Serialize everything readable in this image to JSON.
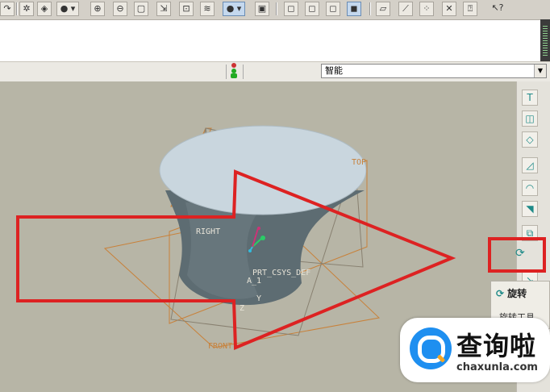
{
  "toolbar": {
    "icons": [
      "redo-icon",
      "regenerate-icon",
      "repaint-icon",
      "shading-icon",
      "zoom-in-icon",
      "zoom-out-icon",
      "refit-icon",
      "reorient-icon",
      "saved-view-icon",
      "layers-icon",
      "appearance-icon",
      "snapshot-icon",
      "wireframe-icon",
      "hidden-line-icon",
      "no-hidden-icon",
      "shaded-icon",
      "datum-planes-icon",
      "datum-axes-icon",
      "datum-points-icon",
      "csys-icon",
      "annotations-icon",
      "whats-this-icon"
    ]
  },
  "filter": {
    "selected": "智能"
  },
  "viewport": {
    "datum_labels": {
      "top": "TOP",
      "right": "RIGHT",
      "front": "FRONT",
      "csys": "PRT_CSYS_DEF",
      "a1": "A_1",
      "z": "Z",
      "y": "Y"
    }
  },
  "right_toolbar": {
    "icons": [
      "hole-icon",
      "shell-icon",
      "rib-icon",
      "draft-icon",
      "round-icon",
      "chamfer-icon",
      "pattern-icon",
      "revolve-icon",
      "sweep-icon"
    ]
  },
  "tooltip": {
    "title": "旋转",
    "description": "旋转工具"
  },
  "watermark": {
    "name": "查询啦",
    "url": "chaxunla.com"
  },
  "colors": {
    "viewport_bg": "#b7b5a6",
    "annotation_red": "#dd2222",
    "solid_body": "#5d6c72",
    "solid_top": "#c9d6de",
    "datum": "#c8813a"
  }
}
